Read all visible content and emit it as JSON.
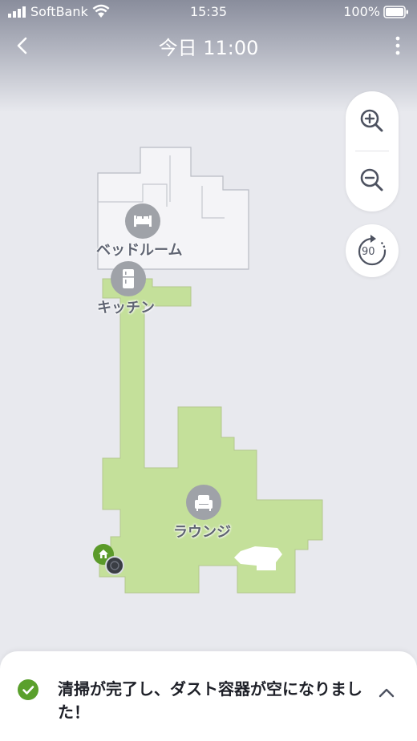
{
  "status_bar": {
    "carrier": "SoftBank",
    "time": "15:35",
    "battery": "100%",
    "signal_icon": "signal-bars-icon",
    "wifi_icon": "wifi-icon",
    "battery_icon": "battery-full-icon"
  },
  "header": {
    "title": "今日 11:00",
    "back_icon": "chevron-left-icon",
    "more_icon": "more-vertical-icon"
  },
  "map_controls": {
    "zoom_in_icon": "zoom-in-icon",
    "zoom_out_icon": "zoom-out-icon",
    "rotate_label": "90",
    "rotate_icon": "rotate-icon"
  },
  "rooms": [
    {
      "name": "ベッドルーム",
      "icon": "bed-icon",
      "cleaned": false
    },
    {
      "name": "キッチン",
      "icon": "refrigerator-icon",
      "cleaned": true
    },
    {
      "name": "ラウンジ",
      "icon": "armchair-icon",
      "cleaned": true
    }
  ],
  "map_markers": {
    "home_icon": "home-base-icon",
    "robot_icon": "robot-icon"
  },
  "colors": {
    "cleaned_area": "#c4e09a",
    "uncleaned_area": "#f4f4f7",
    "success": "#5aa02c",
    "home_base": "#5b9a2a"
  },
  "notification": {
    "message": "清掃が完了し、ダスト容器が空になりました！",
    "status_icon": "check-circle-icon",
    "expand_icon": "chevron-up-icon"
  }
}
